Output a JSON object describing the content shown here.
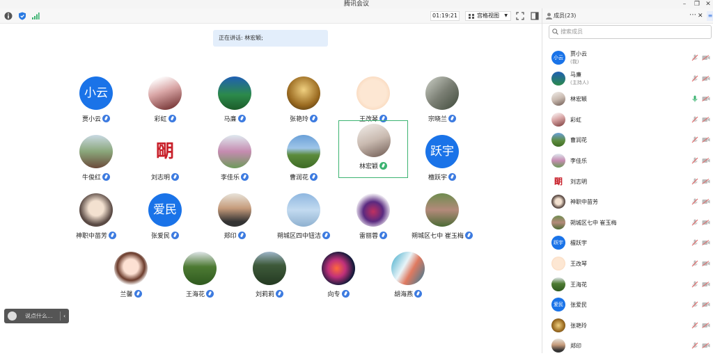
{
  "window": {
    "title": "腾讯会议"
  },
  "toolbar": {
    "timer": "01:19:21",
    "view_mode": "宫格视图"
  },
  "speaking": {
    "text": "正在讲话: 林宏颖;"
  },
  "grid": [
    {
      "name": "贾小云",
      "avatar_text": "小云",
      "color": "#1a73e8"
    },
    {
      "name": "彩虹",
      "avatar_style": "linear-gradient(160deg,#fff 10%,#d9a6a6 45%,#7a3a3a 90%)"
    },
    {
      "name": "马亷",
      "avatar_style": "linear-gradient(180deg,#1f5fb3 0%,#2c8a4b 55%,#1c5c2a 100%)"
    },
    {
      "name": "张艳玲",
      "avatar_style": "radial-gradient(circle at 50% 40%,#f0d080,#9a6a20 60%,#3a2a10)"
    },
    {
      "name": "王改琴",
      "avatar_style": "radial-gradient(circle,#fde7d3 55%,#f5c9a5)"
    },
    {
      "name": "宗晓兰",
      "avatar_style": "linear-gradient(135deg,#cdd1c8,#7b7f74 50%,#3f4a3b)"
    },
    {
      "name": "牛俊红",
      "avatar_style": "linear-gradient(180deg,#c9d9e3 0%,#8aa67a 50%,#6b4a3a 100%)"
    },
    {
      "name": "刘志明",
      "avatar_style": "radial-gradient(circle,#fff 40%,#fff)",
      "seal": "朙"
    },
    {
      "name": "李佳乐",
      "avatar_style": "linear-gradient(180deg,#dfe9ef 0%,#c58bb0 50%,#6d9a5a 100%)"
    },
    {
      "name": "曹润花",
      "avatar_style": "linear-gradient(180deg,#6aa0d8 0%,#9ec5e8 40%,#5c8b3c 60%,#3e6b25 100%)"
    },
    {
      "name": "林宏颖",
      "avatar_style": "linear-gradient(160deg,#f2eeea,#c9bab0 50%,#6e5a52)",
      "active": true
    },
    {
      "name": "檀跃宇",
      "avatar_text": "跃宇",
      "color": "#1a73e8"
    },
    {
      "name": "神职中苗芳",
      "avatar_style": "radial-gradient(circle at 50% 45%,#f3e1d0 30%,#5a4a44 65%)"
    },
    {
      "name": "张爱民",
      "avatar_text": "爱民",
      "color": "#1a73e8"
    },
    {
      "name": "郑印",
      "avatar_style": "linear-gradient(180deg,#e8e3da 0%,#c59b7b 45%,#333 85%)"
    },
    {
      "name": "朔城区四中钮洁",
      "avatar_style": "linear-gradient(180deg,#8fb7e0 0%,#c2daf0 50%,#8fb1d0 100%)"
    },
    {
      "name": "雷丽蓉",
      "avatar_style": "radial-gradient(circle at 50% 55%,#c03060,#5a2a80 40%,#fff 75%)"
    },
    {
      "name": "朔城区七中 崔玉梅",
      "avatar_style": "linear-gradient(180deg,#6f8c4f 0%,#b38a7a 50%,#4c6b35 100%)"
    },
    {
      "name": "兰馨",
      "avatar_style": "radial-gradient(circle at 50% 45%,#fde1d3 30%,#6b3b2b 55%,#fff 75%)"
    },
    {
      "name": "王海花",
      "avatar_style": "linear-gradient(180deg,#dfe6e8 0%,#4d7a33 45%,#2f5a1f 100%)"
    },
    {
      "name": "刘莉莉",
      "avatar_style": "linear-gradient(180deg,#9fb6c9 0%,#3e5a3a 40%,#243a22 100%)"
    },
    {
      "name": "向专",
      "avatar_style": "radial-gradient(circle at 45% 50%,#ff6a3a,#c0307a 35%,#141a3a 70%)"
    },
    {
      "name": "胡海燕",
      "avatar_style": "linear-gradient(120deg,#3aa8c8 0%,#e8f4f8 40%,#e07a60 60%,#2a7a9a 100%)"
    }
  ],
  "chat": {
    "placeholder": "说点什么..."
  },
  "members_panel": {
    "title": "成员(23)",
    "search_placeholder": "搜索成员",
    "members": [
      {
        "name": "贾小云",
        "role": "(我)",
        "avatar_text": "小云"
      },
      {
        "name": "马亷",
        "role": "(主持人)",
        "avatar_style": "linear-gradient(180deg,#1f5fb3,#2c8a4b)"
      },
      {
        "name": "林宏颖",
        "avatar_style": "linear-gradient(160deg,#f2eeea,#c9bab0 50%,#6e5a52)",
        "speaking": true
      },
      {
        "name": "彩虹",
        "avatar_style": "linear-gradient(160deg,#fff,#d9a6a6 45%,#7a3a3a)"
      },
      {
        "name": "曹润花",
        "avatar_style": "linear-gradient(180deg,#6aa0d8,#5c8b3c 60%,#3e6b25)"
      },
      {
        "name": "李佳乐",
        "avatar_style": "linear-gradient(180deg,#dfe9ef,#c58bb0 50%,#6d9a5a)"
      },
      {
        "name": "刘志明",
        "avatar_style": "radial-gradient(circle,#fff 40%,#fff)",
        "seal": "朙"
      },
      {
        "name": "神职中苗芳",
        "avatar_style": "radial-gradient(circle,#f3e1d0 30%,#5a4a44 65%)"
      },
      {
        "name": "朔城区七中 崔玉梅",
        "avatar_style": "linear-gradient(180deg,#6f8c4f,#b38a7a 50%,#4c6b35)"
      },
      {
        "name": "檀跃宇",
        "avatar_text": "跃宇"
      },
      {
        "name": "王改琴",
        "avatar_style": "radial-gradient(circle,#fde7d3 55%,#f5c9a5)"
      },
      {
        "name": "王海花",
        "avatar_style": "linear-gradient(180deg,#dfe6e8,#4d7a33 45%,#2f5a1f)"
      },
      {
        "name": "张爱民",
        "avatar_text": "爱民"
      },
      {
        "name": "张艳玲",
        "avatar_style": "radial-gradient(circle,#f0d080,#9a6a20 60%,#3a2a10)"
      },
      {
        "name": "郑印",
        "avatar_style": "linear-gradient(180deg,#e8e3da,#c59b7b 45%,#333 85%)"
      }
    ]
  },
  "icons": {
    "info": "info-icon",
    "shield": "shield-icon",
    "signal": "signal-icon",
    "fullscreen": "fullscreen-icon",
    "sidebar": "sidebar-toggle-icon",
    "mic_muted": "mic-muted-icon",
    "cam_off": "camera-off-icon"
  },
  "colors": {
    "accent": "#1a73e8",
    "speaking": "#3cb371",
    "muted": "#e06a6a"
  }
}
